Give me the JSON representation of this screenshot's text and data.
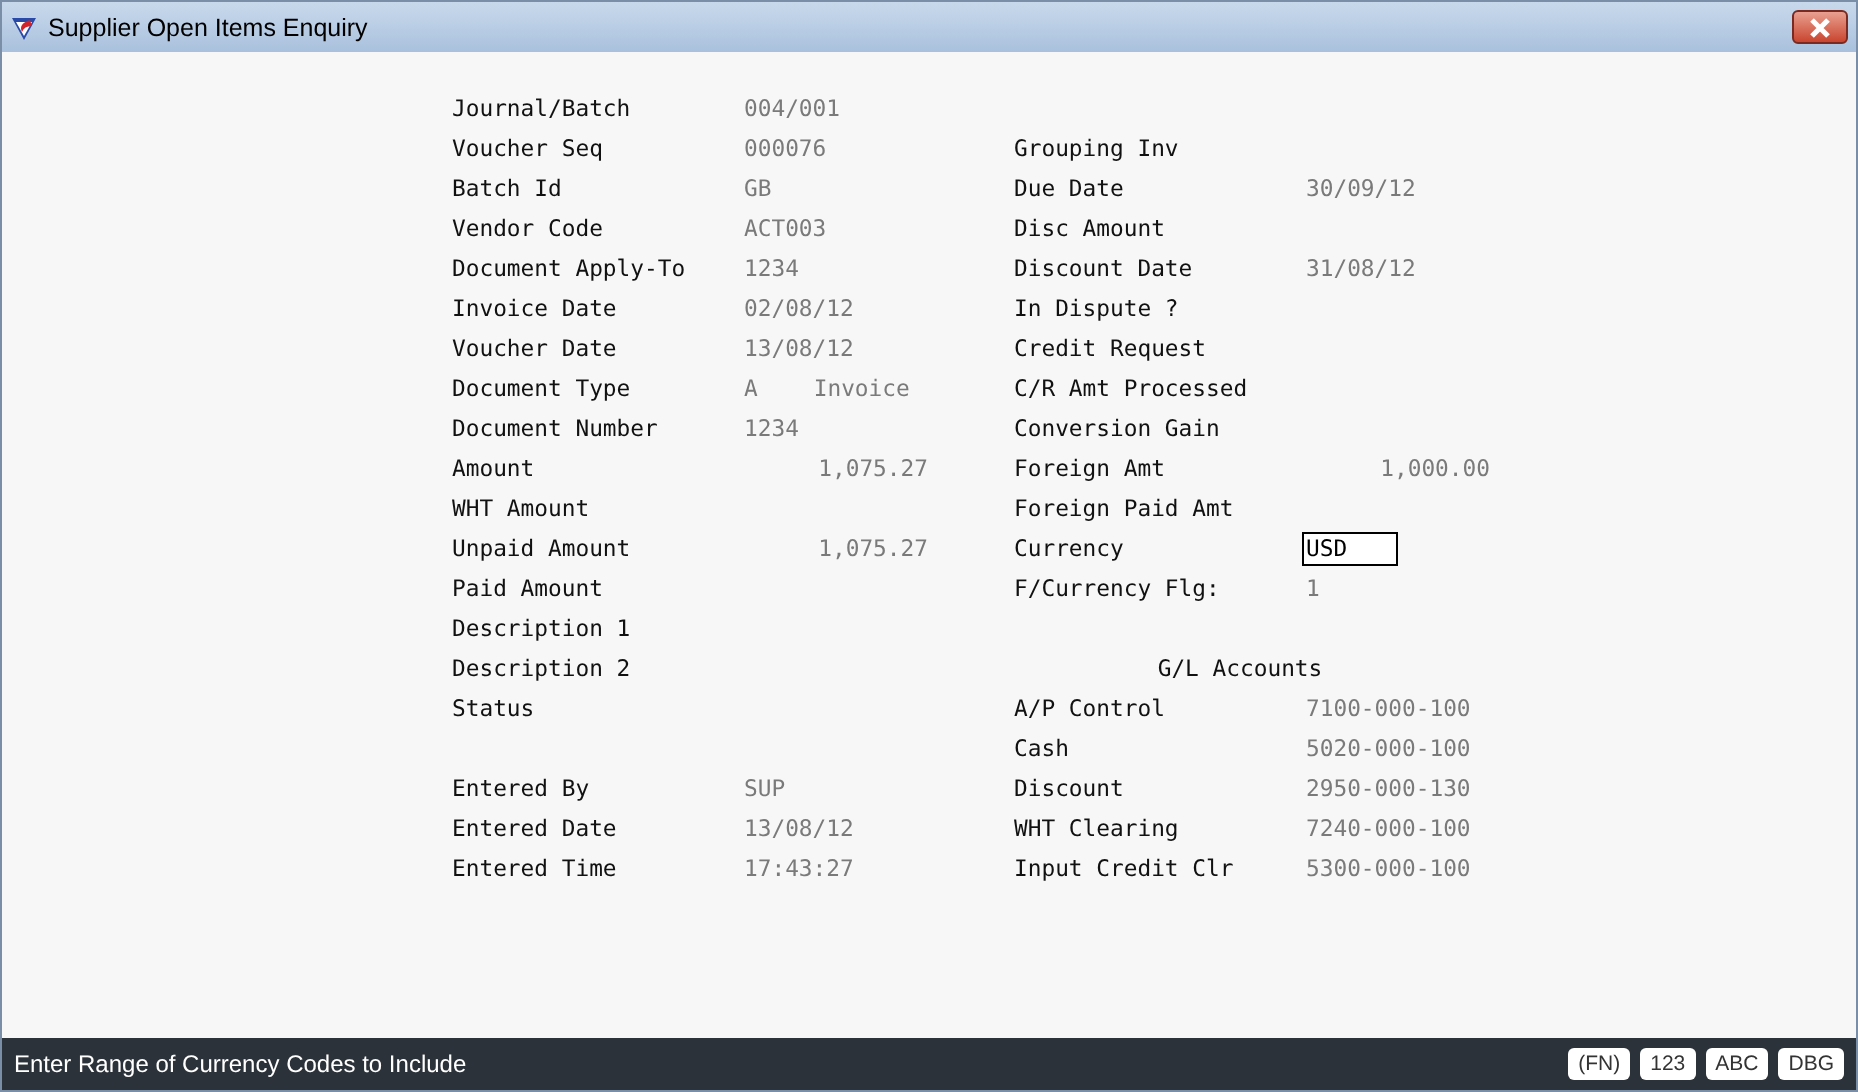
{
  "window": {
    "title": "Supplier Open Items Enquiry"
  },
  "document": [
    {
      "label": "Journal/Batch",
      "value": "004/001",
      "kind": "text"
    },
    {
      "label": "Voucher Seq",
      "value": "000076",
      "kind": "text"
    },
    {
      "label": "Batch Id",
      "value": "GB",
      "kind": "text"
    },
    {
      "label": "Vendor Code",
      "value": "ACT003",
      "kind": "text"
    },
    {
      "label": "Document Apply-To",
      "value": "1234",
      "kind": "text"
    },
    {
      "label": "Invoice Date",
      "value": "02/08/12",
      "kind": "text"
    },
    {
      "label": "Voucher Date",
      "value": "13/08/12",
      "kind": "text"
    },
    {
      "label": "Document Type",
      "value": "A",
      "description": "Invoice",
      "kind": "text"
    },
    {
      "label": "Document Number",
      "value": "1234",
      "kind": "text"
    },
    {
      "label": "Amount",
      "value": "1,075.27",
      "kind": "amount"
    },
    {
      "label": "WHT Amount",
      "kind": "text"
    },
    {
      "label": "Unpaid Amount",
      "value": "1,075.27",
      "kind": "amount"
    },
    {
      "label": "Paid Amount",
      "kind": "text"
    },
    {
      "label": "Description 1",
      "kind": "text"
    },
    {
      "label": "Description 2",
      "kind": "text"
    },
    {
      "label": "Status",
      "kind": "text"
    }
  ],
  "entry": [
    {
      "label": "Entered By",
      "value": "SUP",
      "kind": "text"
    },
    {
      "label": "Entered Date",
      "value": "13/08/12",
      "kind": "text"
    },
    {
      "label": "Entered Time",
      "value": "17:43:27",
      "kind": "text"
    }
  ],
  "details": [
    {
      "label": "Grouping Inv",
      "kind": "text"
    },
    {
      "label": "Due Date",
      "value": "30/09/12",
      "kind": "text"
    },
    {
      "label": "Disc Amount",
      "kind": "text"
    },
    {
      "label": "Discount Date",
      "value": "31/08/12",
      "kind": "text"
    },
    {
      "label": "In Dispute ?",
      "kind": "text"
    },
    {
      "label": "Credit Request",
      "kind": "text"
    },
    {
      "label": "C/R Amt Processed",
      "kind": "text"
    },
    {
      "label": "Conversion Gain",
      "kind": "text"
    },
    {
      "label": "Foreign Amt",
      "value": "1,000.00",
      "kind": "amount"
    },
    {
      "label": "Foreign Paid Amt",
      "kind": "text"
    },
    {
      "label": "Currency",
      "value": "USD",
      "kind": "input"
    },
    {
      "label": "F/Currency Flg:",
      "value": "1",
      "kind": "text"
    }
  ],
  "gl_accounts": {
    "title": "G/L Accounts",
    "accounts": [
      {
        "label": "A/P Control",
        "value": "7100-000-100",
        "kind": "text"
      },
      {
        "label": "Cash",
        "value": "5020-000-100",
        "kind": "text"
      },
      {
        "label": "Discount",
        "value": "2950-000-130",
        "kind": "text"
      },
      {
        "label": "WHT Clearing",
        "value": "7240-000-100",
        "kind": "text"
      },
      {
        "label": "Input Credit Clr",
        "value": "5300-000-100",
        "kind": "text"
      }
    ]
  },
  "status_bar": {
    "message": "Enter Range of Currency Codes to Include",
    "indicators": [
      "(FN)",
      "123",
      "ABC",
      "DBG"
    ]
  }
}
